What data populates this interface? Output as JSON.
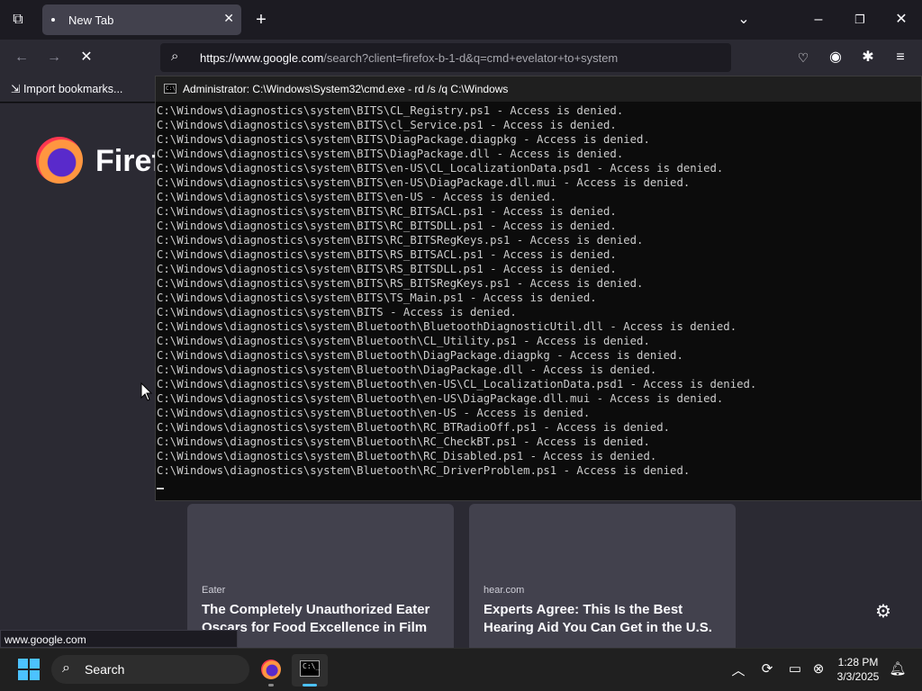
{
  "browser": {
    "tab_title": "New Tab",
    "url_host": "https://www.google.com",
    "url_rest": "/search?client=firefox-b-1-d&q=cmd+evelator+to+system",
    "bookmarks_import": "Import bookmarks...",
    "brand_text": "Firef",
    "status_url": "www.google.com"
  },
  "cards": [
    {
      "source": "Eater",
      "title": "The Completely Unauthorized Eater Oscars for Food Excellence in Film"
    },
    {
      "source": "hear.com",
      "title": "Experts Agree: This Is the Best Hearing Aid You Can Get in the U.S."
    }
  ],
  "cmd": {
    "title": "Administrator: C:\\Windows\\System32\\cmd.exe - rd  /s /q C:\\Windows",
    "lines": [
      "C:\\Windows\\diagnostics\\system\\BITS\\CL_Registry.ps1 - Access is denied.",
      "C:\\Windows\\diagnostics\\system\\BITS\\cl_Service.ps1 - Access is denied.",
      "C:\\Windows\\diagnostics\\system\\BITS\\DiagPackage.diagpkg - Access is denied.",
      "C:\\Windows\\diagnostics\\system\\BITS\\DiagPackage.dll - Access is denied.",
      "C:\\Windows\\diagnostics\\system\\BITS\\en-US\\CL_LocalizationData.psd1 - Access is denied.",
      "C:\\Windows\\diagnostics\\system\\BITS\\en-US\\DiagPackage.dll.mui - Access is denied.",
      "C:\\Windows\\diagnostics\\system\\BITS\\en-US - Access is denied.",
      "C:\\Windows\\diagnostics\\system\\BITS\\RC_BITSACL.ps1 - Access is denied.",
      "C:\\Windows\\diagnostics\\system\\BITS\\RC_BITSDLL.ps1 - Access is denied.",
      "C:\\Windows\\diagnostics\\system\\BITS\\RC_BITSRegKeys.ps1 - Access is denied.",
      "C:\\Windows\\diagnostics\\system\\BITS\\RS_BITSACL.ps1 - Access is denied.",
      "C:\\Windows\\diagnostics\\system\\BITS\\RS_BITSDLL.ps1 - Access is denied.",
      "C:\\Windows\\diagnostics\\system\\BITS\\RS_BITSRegKeys.ps1 - Access is denied.",
      "C:\\Windows\\diagnostics\\system\\BITS\\TS_Main.ps1 - Access is denied.",
      "C:\\Windows\\diagnostics\\system\\BITS - Access is denied.",
      "C:\\Windows\\diagnostics\\system\\Bluetooth\\BluetoothDiagnosticUtil.dll - Access is denied.",
      "C:\\Windows\\diagnostics\\system\\Bluetooth\\CL_Utility.ps1 - Access is denied.",
      "C:\\Windows\\diagnostics\\system\\Bluetooth\\DiagPackage.diagpkg - Access is denied.",
      "C:\\Windows\\diagnostics\\system\\Bluetooth\\DiagPackage.dll - Access is denied.",
      "C:\\Windows\\diagnostics\\system\\Bluetooth\\en-US\\CL_LocalizationData.psd1 - Access is denied.",
      "C:\\Windows\\diagnostics\\system\\Bluetooth\\en-US\\DiagPackage.dll.mui - Access is denied.",
      "C:\\Windows\\diagnostics\\system\\Bluetooth\\en-US - Access is denied.",
      "C:\\Windows\\diagnostics\\system\\Bluetooth\\RC_BTRadioOff.ps1 - Access is denied.",
      "C:\\Windows\\diagnostics\\system\\Bluetooth\\RC_CheckBT.ps1 - Access is denied.",
      "C:\\Windows\\diagnostics\\system\\Bluetooth\\RC_Disabled.ps1 - Access is denied.",
      "C:\\Windows\\diagnostics\\system\\Bluetooth\\RC_DriverProblem.ps1 - Access is denied."
    ]
  },
  "taskbar": {
    "search_label": "Search",
    "time": "1:28 PM",
    "date": "3/3/2025"
  },
  "colors": {
    "accent": "#4cc2ff",
    "terminal_text": "#cccccc",
    "browser_bg": "#2b2a33"
  }
}
